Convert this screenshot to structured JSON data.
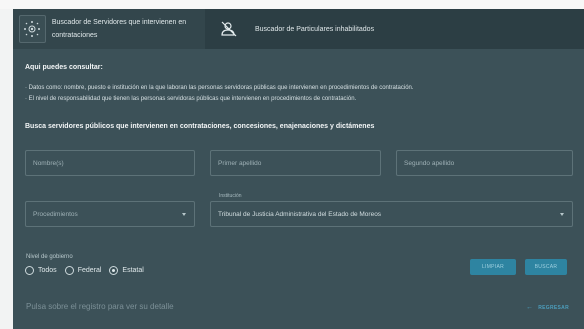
{
  "tabs": [
    {
      "label": "Buscador de Servidores que intervienen en contrataciones",
      "icon": "servers-network-icon"
    },
    {
      "label": "Buscador de Particulares inhabilitados",
      "icon": "user-blocked-icon"
    }
  ],
  "info": {
    "heading": "Aqui puedes consultar:",
    "bullets": [
      "· Datos como: nombre, puesto e institución en la que laboran las personas servidoras públicas que intervienen en procedimientos de contratación.",
      "· El nivel de responsabilidad que tienen las personas servidoras públicas que intervienen en procedimientos de contratación."
    ]
  },
  "search": {
    "heading": "Busca servidores públicos que intervienen en contrataciones, concesiones, enajenaciones y dictámenes",
    "nombre_placeholder": "Nombre(s)",
    "primer_apellido_placeholder": "Primer apellido",
    "segundo_apellido_placeholder": "Segundo apellido",
    "procedimientos_placeholder": "Procedimientos",
    "institucion_label": "Institución",
    "institucion_value": "Tribunal de Justicia Administrativa del Estado de Moreos"
  },
  "nivel": {
    "label": "Nivel de gobierno",
    "options": [
      "Todos",
      "Federal",
      "Estatal"
    ],
    "selected": "Estatal"
  },
  "buttons": {
    "clear": "LIMPIAR",
    "search": "BUSCAR"
  },
  "footer": {
    "hint": "Pulsa sobre el registro para ver su detalle",
    "back": "REGRESAR"
  },
  "colors": {
    "panel": "#3c5158",
    "tab_active": "#33464c",
    "accent": "#2e84a1"
  }
}
